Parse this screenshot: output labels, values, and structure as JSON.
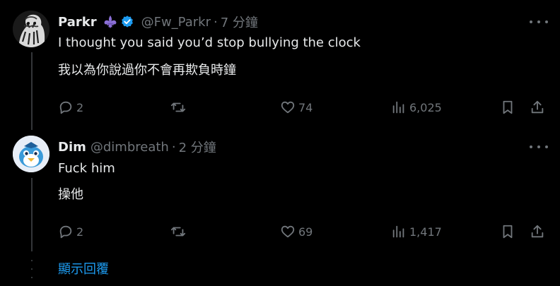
{
  "colors": {
    "background": "#000000",
    "text_primary": "#e7e9ea",
    "text_secondary": "#71767b",
    "accent": "#1d9bf0",
    "thread_line": "#333639",
    "fleur_purple": "#8b6fd6",
    "dim_avatar_bg": "#e8eef7"
  },
  "tweets": [
    {
      "display_name": "Parkr",
      "badge_icon": "fleur-de-lis-icon",
      "verified_icon": "verified-badge-icon",
      "handle": "@Fw_Parkr",
      "separator": "·",
      "time": "7 分鐘",
      "text_line_1": "I thought you said you’d stop bullying the clock",
      "text_line_2": "我以為你說過你不會再欺負時鐘",
      "actions": {
        "replies": "2",
        "reposts": "",
        "likes": "74",
        "views": "6,025"
      }
    },
    {
      "display_name": "Dim",
      "handle": "@dimbreath",
      "separator": "·",
      "time": "2 分鐘",
      "text_line_1": "Fuck him",
      "text_line_2": "操他",
      "actions": {
        "replies": "2",
        "reposts": "",
        "likes": "69",
        "views": "1,417"
      }
    }
  ],
  "show_replies_label": "顯示回覆"
}
